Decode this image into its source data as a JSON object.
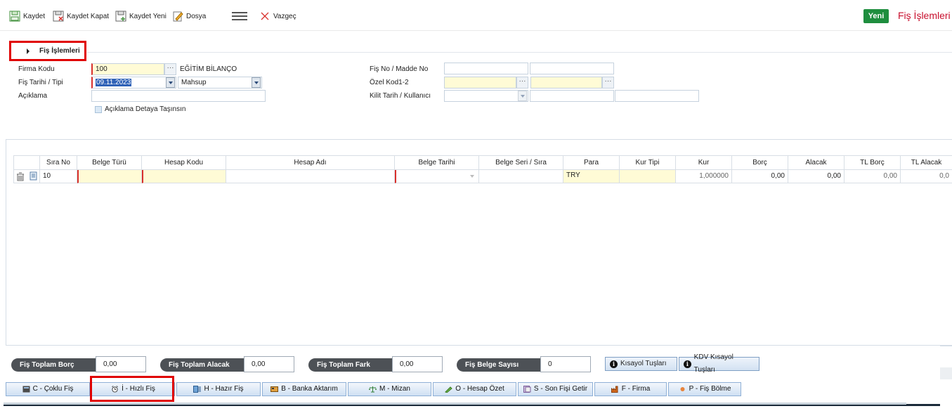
{
  "toolbar": {
    "kaydet": "Kaydet",
    "kaydet_kapat": "Kaydet Kapat",
    "kaydet_yeni": "Kaydet Yeni",
    "dosya": "Dosya",
    "vazgec": "Vazgeç",
    "yeni": "Yeni",
    "title": "Fiş İşlemleri"
  },
  "section": {
    "title": "Fiş İşlemleri"
  },
  "form": {
    "firma_kodu_label": "Firma Kodu",
    "firma_kodu_value": "100",
    "firma_name": "EĞİTİM BİLANÇO",
    "fis_tarihi_label": "Fiş Tarihi / Tipi",
    "fis_tarihi_value": "09.11.2023",
    "fis_tipi_value": "Mahsup",
    "aciklama_label": "Açıklama",
    "aciklama_value": "",
    "aciklama_detay_label": "Açıklama Detaya Taşınsın",
    "fis_no_label": "Fiş No / Madde No",
    "ozel_kod_label": "Özel Kod1-2",
    "kilit_label": "Kilit Tarih / Kullanıcı"
  },
  "grid": {
    "columns": [
      "Sıra No",
      "Belge Türü",
      "Hesap Kodu",
      "Hesap Adı",
      "Belge Tarihi",
      "Belge Seri / Sıra",
      "Para",
      "Kur Tipi",
      "Kur",
      "Borç",
      "Alacak",
      "TL Borç",
      "TL Alacak"
    ],
    "rows": [
      {
        "sira_no": "10",
        "belge_turu": "",
        "hesap_kodu": "",
        "hesap_adi": "",
        "belge_tarihi": "",
        "belge_seri": "",
        "para": "TRY",
        "kur_tipi": "",
        "kur": "1,000000",
        "borc": "0,00",
        "alacak": "0,00",
        "tl_borc": "0,00",
        "tl_alacak": "0,0"
      }
    ]
  },
  "totals": {
    "toplam_borc_label": "Fiş Toplam Borç",
    "toplam_borc": "0,00",
    "toplam_alacak_label": "Fiş Toplam Alacak",
    "toplam_alacak": "0,00",
    "toplam_fark_label": "Fiş Toplam Fark",
    "toplam_fark": "0,00",
    "belge_sayisi_label": "Fiş Belge Sayısı",
    "belge_sayisi": "0",
    "kisayol": "Kısayol Tuşları",
    "kdv_kisayol": "KDV Kısayol Tuşları"
  },
  "tabs": [
    "C - Çoklu Fiş",
    "İ - Hızlı Fiş",
    "H - Hazır Fiş",
    "B - Banka Aktarım",
    "M - Mizan",
    "O - Hesap Özet",
    "S - Son Fişi Getir",
    "F - Firma",
    "P - Fiş Bölme"
  ],
  "colors": {
    "accent_red": "#c8102e",
    "yeni_green": "#1e8e3e",
    "required_yellow": "#fffbd6"
  }
}
